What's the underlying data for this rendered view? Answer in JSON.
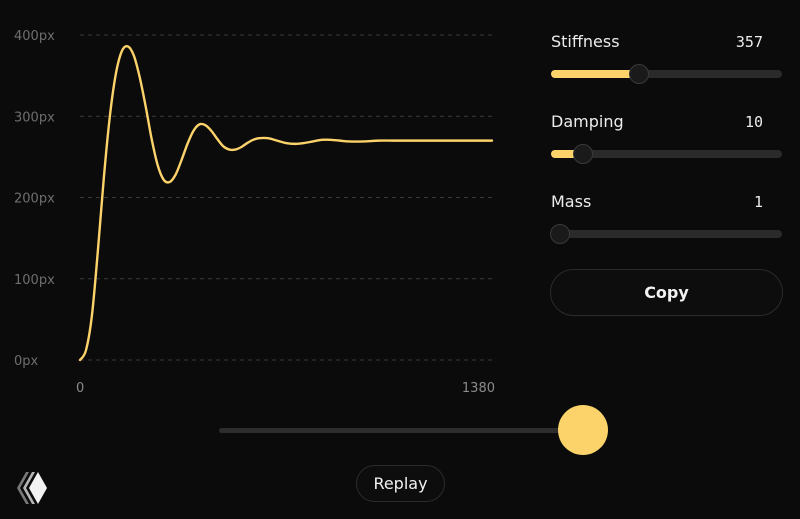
{
  "controls": {
    "stiffness": {
      "label": "Stiffness",
      "value": "357",
      "fraction": 0.37
    },
    "damping": {
      "label": "Damping",
      "value": "10",
      "fraction": 0.11
    },
    "mass": {
      "label": "Mass",
      "value": "1",
      "fraction": 0.0
    }
  },
  "buttons": {
    "copy_label": "Copy",
    "replay_label": "Replay"
  },
  "scrubber": {
    "fraction": 1.0
  },
  "colors": {
    "accent": "#fbd36a",
    "background": "#0b0b0b",
    "muted_text": "#6e6e6e"
  },
  "icons": {
    "logo": "chevrons-logo-icon"
  },
  "chart_data": {
    "type": "line",
    "xlabel": "",
    "ylabel": "",
    "xlim": [
      0,
      1380
    ],
    "ylim": [
      0,
      400
    ],
    "x_ticks": [
      "0",
      "1380"
    ],
    "y_ticks": [
      "0px",
      "100px",
      "200px",
      "300px",
      "400px"
    ],
    "grid": true,
    "series": [
      {
        "x": [
          0,
          20,
          40,
          60,
          80,
          100,
          120,
          140,
          160,
          180,
          200,
          220,
          240,
          260,
          280,
          300,
          320,
          340,
          360,
          380,
          400,
          420,
          440,
          460,
          480,
          500,
          520,
          540,
          560,
          580,
          600,
          630,
          660,
          690,
          720,
          750,
          780,
          810,
          840,
          870,
          900,
          950,
          1000,
          1050,
          1100,
          1150,
          1200,
          1250,
          1300,
          1350,
          1380
        ],
        "y": [
          0,
          12,
          55,
          135,
          225,
          300,
          352,
          380,
          386,
          375,
          348,
          312,
          272,
          240,
          222,
          219,
          228,
          246,
          266,
          282,
          290,
          289,
          282,
          272,
          263,
          259,
          259,
          262,
          267,
          271,
          273,
          273,
          270,
          267,
          266,
          267,
          269,
          271,
          271,
          270,
          269,
          269,
          270,
          270,
          270,
          270,
          270,
          270,
          270,
          270,
          270
        ]
      }
    ]
  }
}
